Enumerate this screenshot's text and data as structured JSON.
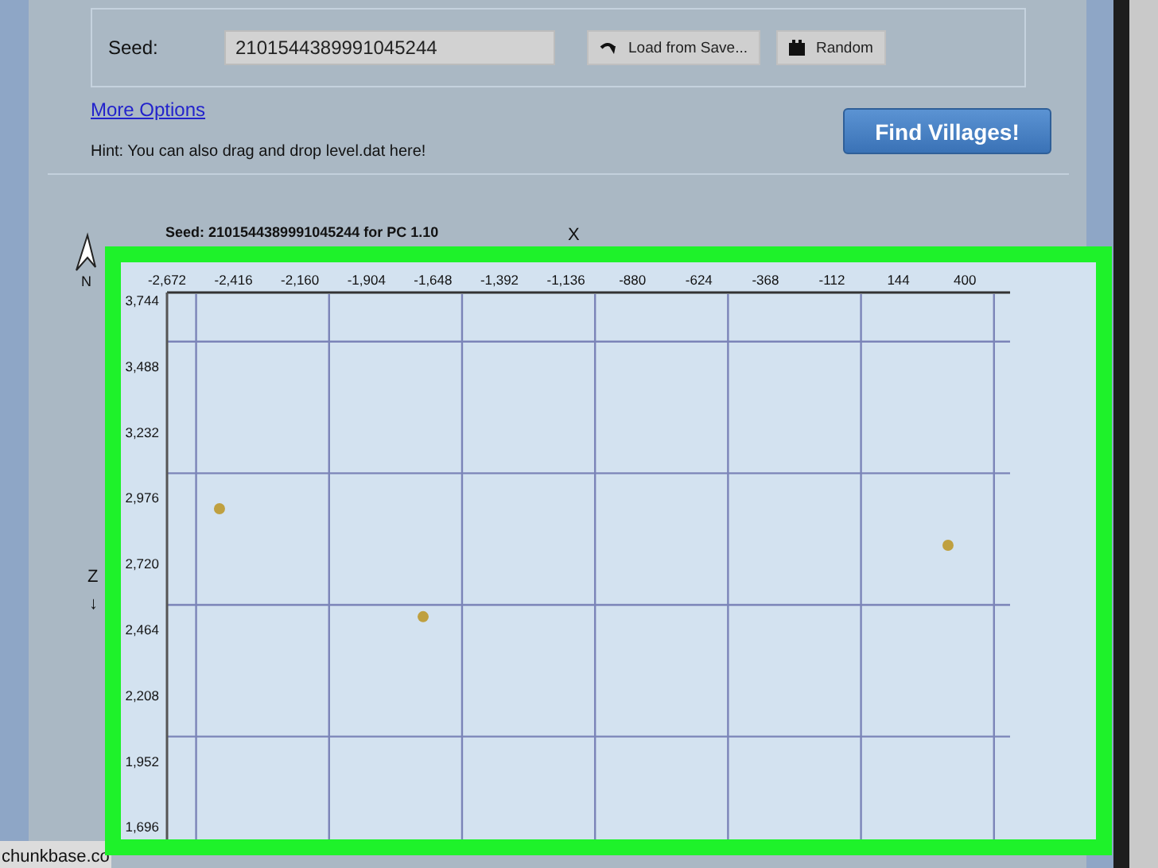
{
  "seed_form": {
    "label": "Seed:",
    "seed": "2101544389991045244",
    "load_button": "Load from Save...",
    "random_button": "Random"
  },
  "more_options_link": "More Options",
  "hint": "Hint: You can also drag and drop level.dat here!",
  "find_button": "Find Villages!",
  "map": {
    "caption": "Seed: 2101544389991045244  for PC 1.10",
    "north_label": "N",
    "x_axis_label": "X",
    "z_axis_label": "Z",
    "z_arrow": "↓",
    "chart_data": {
      "type": "scatter",
      "xlim": [
        -2672,
        574
      ],
      "ylim": [
        1635,
        3775
      ],
      "xticks": [
        {
          "value": -2672,
          "label": "-2,672"
        },
        {
          "value": -2416,
          "label": "-2,416"
        },
        {
          "value": -2160,
          "label": "-2,160"
        },
        {
          "value": -1904,
          "label": "-1,904"
        },
        {
          "value": -1648,
          "label": "-1,648"
        },
        {
          "value": -1392,
          "label": "-1,392"
        },
        {
          "value": -1136,
          "label": "-1,136"
        },
        {
          "value": -880,
          "label": "-880"
        },
        {
          "value": -624,
          "label": "-624"
        },
        {
          "value": -368,
          "label": "-368"
        },
        {
          "value": -112,
          "label": "-112"
        },
        {
          "value": 144,
          "label": "144"
        },
        {
          "value": 400,
          "label": "400"
        }
      ],
      "yticks": [
        {
          "value": 3744,
          "label": "3,744"
        },
        {
          "value": 3488,
          "label": "3,488"
        },
        {
          "value": 3232,
          "label": "3,232"
        },
        {
          "value": 2976,
          "label": "2,976"
        },
        {
          "value": 2720,
          "label": "2,720"
        },
        {
          "value": 2464,
          "label": "2,464"
        },
        {
          "value": 2208,
          "label": "2,208"
        },
        {
          "value": 1952,
          "label": "1,952"
        },
        {
          "value": 1696,
          "label": "1,696"
        }
      ],
      "x": [
        -2470,
        -1686,
        335
      ],
      "series": [
        {
          "color": "#bfa040",
          "values": [
            2934,
            2514,
            2792
          ]
        }
      ]
    }
  },
  "status_bar": "chunkbase.co"
}
